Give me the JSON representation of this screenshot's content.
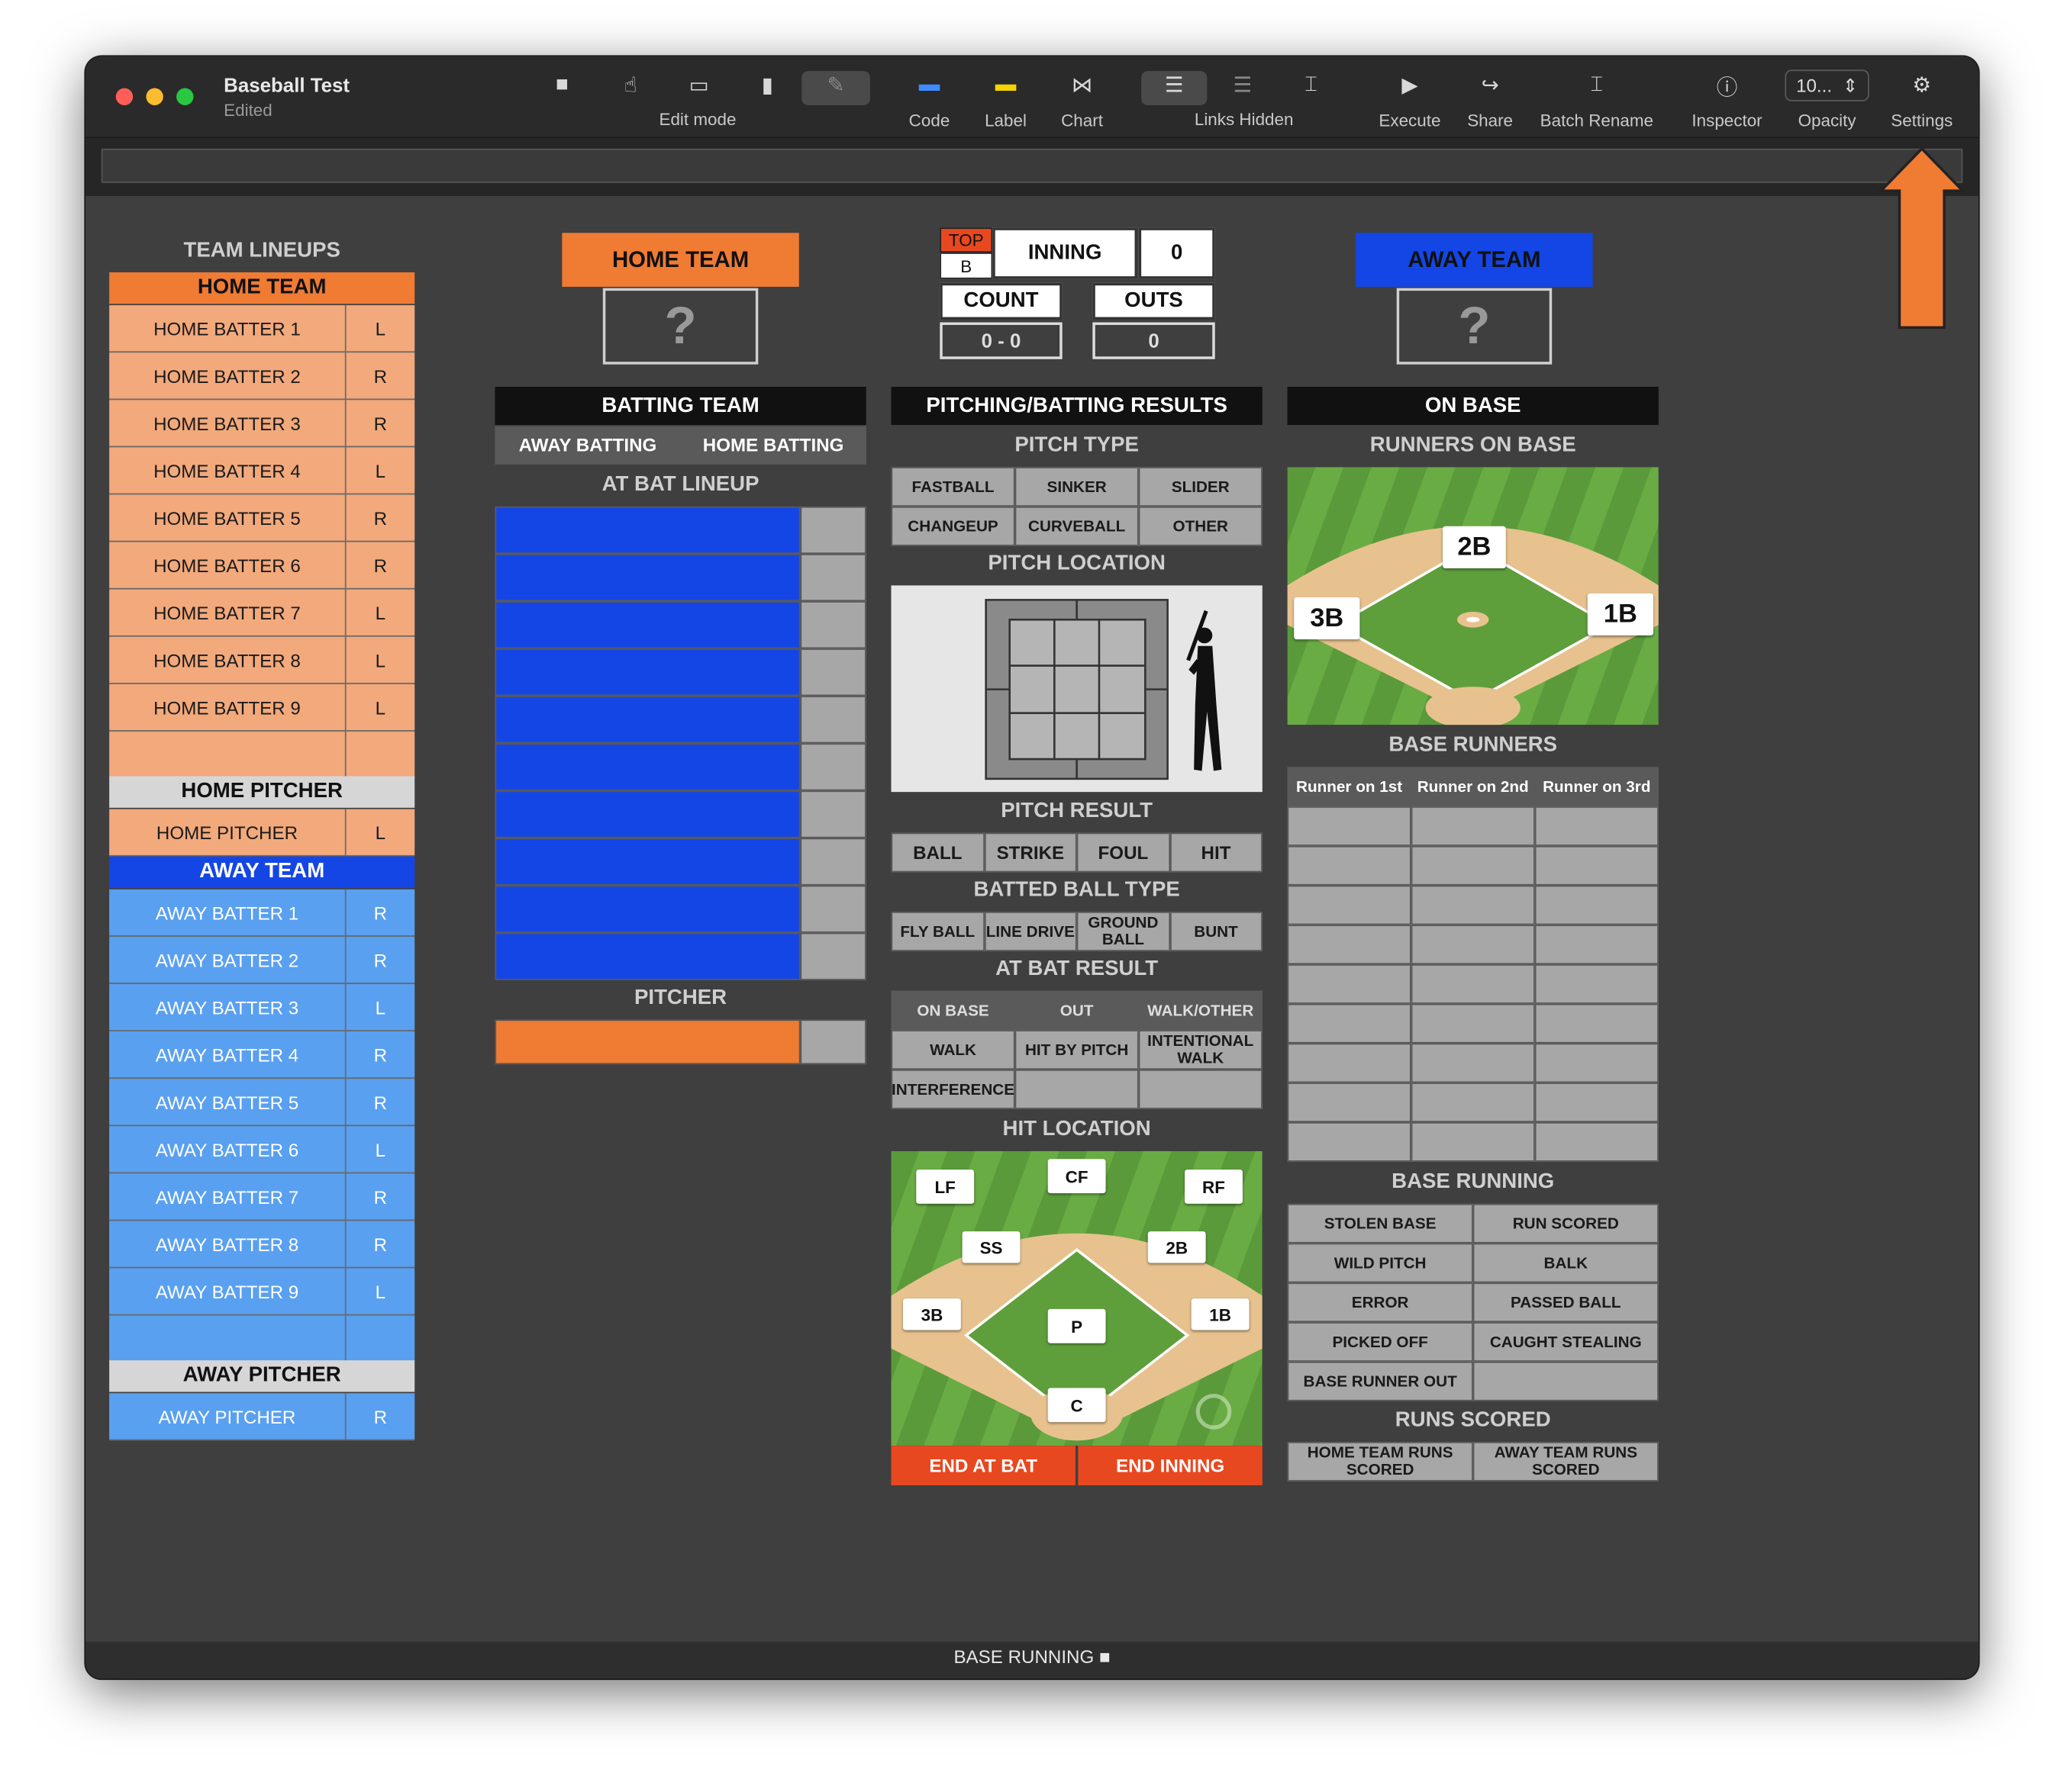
{
  "window": {
    "title": "Baseball Test",
    "subtitle": "Edited"
  },
  "toolbar": {
    "edit_mode_label": "Edit mode",
    "code_label": "Code",
    "label_label": "Label",
    "chart_label": "Chart",
    "links_label": "Links Hidden",
    "execute_label": "Execute",
    "share_label": "Share",
    "batch_rename_label": "Batch Rename",
    "inspector_label": "Inspector",
    "opacity_value": "10...",
    "opacity_label": "Opacity",
    "settings_label": "Settings"
  },
  "lineups": {
    "title": "TEAM LINEUPS",
    "home_team_label": "HOME TEAM",
    "home_batters": [
      {
        "name": "HOME BATTER 1",
        "hand": "L"
      },
      {
        "name": "HOME BATTER 2",
        "hand": "R"
      },
      {
        "name": "HOME BATTER 3",
        "hand": "R"
      },
      {
        "name": "HOME BATTER 4",
        "hand": "L"
      },
      {
        "name": "HOME BATTER 5",
        "hand": "R"
      },
      {
        "name": "HOME BATTER 6",
        "hand": "R"
      },
      {
        "name": "HOME BATTER 7",
        "hand": "L"
      },
      {
        "name": "HOME BATTER 8",
        "hand": "L"
      },
      {
        "name": "HOME BATTER 9",
        "hand": "L"
      },
      {
        "name": "",
        "hand": ""
      }
    ],
    "home_pitcher_label": "HOME PITCHER",
    "home_pitcher": {
      "name": "HOME PITCHER",
      "hand": "L"
    },
    "away_team_label": "AWAY TEAM",
    "away_batters": [
      {
        "name": "AWAY BATTER 1",
        "hand": "R"
      },
      {
        "name": "AWAY BATTER 2",
        "hand": "R"
      },
      {
        "name": "AWAY BATTER 3",
        "hand": "L"
      },
      {
        "name": "AWAY BATTER 4",
        "hand": "R"
      },
      {
        "name": "AWAY BATTER 5",
        "hand": "R"
      },
      {
        "name": "AWAY BATTER 6",
        "hand": "L"
      },
      {
        "name": "AWAY BATTER 7",
        "hand": "R"
      },
      {
        "name": "AWAY BATTER 8",
        "hand": "R"
      },
      {
        "name": "AWAY BATTER 9",
        "hand": "L"
      },
      {
        "name": "",
        "hand": ""
      }
    ],
    "away_pitcher_label": "AWAY PITCHER",
    "away_pitcher": {
      "name": "AWAY PITCHER",
      "hand": "R"
    }
  },
  "scoreboard": {
    "home_team_btn": "HOME TEAM",
    "away_team_btn": "AWAY TEAM",
    "home_logo": "?",
    "away_logo": "?",
    "top_label": "TOP",
    "bottom_label": "B",
    "inning_label": "INNING",
    "inning_value": "0",
    "count_label": "COUNT",
    "count_value": "0 - 0",
    "outs_label": "OUTS",
    "outs_value": "0"
  },
  "batting": {
    "header": "BATTING TEAM",
    "away_batting": "AWAY BATTING",
    "home_batting": "HOME BATTING",
    "lineup_label": "AT BAT LINEUP",
    "pitcher_label": "PITCHER"
  },
  "results": {
    "header": "PITCHING/BATTING RESULTS",
    "pitch_type_label": "PITCH TYPE",
    "pitch_types": [
      "FASTBALL",
      "SINKER",
      "SLIDER",
      "CHANGEUP",
      "CURVEBALL",
      "OTHER"
    ],
    "pitch_location_label": "PITCH LOCATION",
    "pitch_result_label": "PITCH RESULT",
    "pitch_results": [
      "BALL",
      "STRIKE",
      "FOUL",
      "HIT"
    ],
    "batted_ball_label": "BATTED BALL TYPE",
    "batted_ball_types": [
      "FLY BALL",
      "LINE DRIVE",
      "GROUND BALL",
      "BUNT"
    ],
    "at_bat_result_label": "AT BAT RESULT",
    "at_bat_results": [
      "ON BASE",
      "OUT",
      "WALK/OTHER",
      "WALK",
      "HIT BY PITCH",
      "INTENTIONAL WALK",
      "INTERFERENCE",
      "",
      ""
    ],
    "hit_location_label": "HIT LOCATION",
    "hit_positions": {
      "lf": "LF",
      "cf": "CF",
      "rf": "RF",
      "ss": "SS",
      "second": "2B",
      "third": "3B",
      "first": "1B",
      "p": "P",
      "c": "C"
    },
    "end_at_bat": "END AT BAT",
    "end_inning": "END INNING"
  },
  "onbase": {
    "header": "ON BASE",
    "runners_label": "RUNNERS ON BASE",
    "bases": {
      "second": "2B",
      "third": "3B",
      "first": "1B"
    },
    "base_runners_label": "BASE RUNNERS",
    "runner_cols": [
      "Runner on 1st",
      "Runner on 2nd",
      "Runner on 3rd"
    ],
    "base_running_label": "BASE RUNNING",
    "base_running": [
      "STOLEN BASE",
      "RUN SCORED",
      "WILD PITCH",
      "BALK",
      "ERROR",
      "PASSED BALL",
      "PICKED OFF",
      "CAUGHT STEALING",
      "BASE RUNNER OUT",
      ""
    ],
    "runs_scored_label": "RUNS SCORED",
    "runs_scored": [
      "HOME TEAM RUNS SCORED",
      "AWAY TEAM RUNS SCORED"
    ]
  },
  "footer": {
    "label": "BASE RUNNING"
  },
  "colors": {
    "home": "#f07b33",
    "away": "#1446e6",
    "end": "#e8481f",
    "header": "#111111"
  }
}
